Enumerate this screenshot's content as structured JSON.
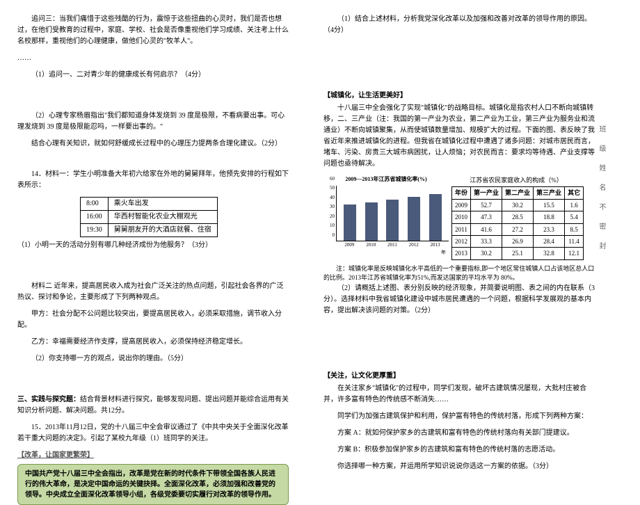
{
  "left": {
    "zw3_label": "追问三：",
    "zw3_text": "当我们痛惜于这些残酷的行为，震惊于这些扭曲的心灵时，我们是否也想过，在他们受教育的过程中，家庭、学校、社会是否像重视他们学习成绩、关注考上什么名校那样，重视他们的心理健康，做他们心灵的\"牧羊人\"。",
    "ellipsis": "……",
    "q1": "（1）追问一、二对青少年的健康成长有何启示？（4分）",
    "q2a": "（2）心理专家杨眉指出\"我们都知道身体发烧到 39 度是极限，不看病要出事。可心理发烧到 39 度是极限能忍吗，一样要出事的。\"",
    "q2b": "结合心理有关知识，就如何舒缓成长过程中的心理压力提两条合理化建议。（2分）",
    "item14": "14．材料一：学生小明准备大年初六给家在外地的舅舅拜年，他预先安排的行程如下表所示：",
    "schedule": [
      [
        "8:00",
        "乘火车出发"
      ],
      [
        "16:00",
        "华西村智能化农业大棚观光"
      ],
      [
        "19:30",
        "舅舅朋友开的大酒店就餐、住宿"
      ]
    ],
    "q14_1": "（1）小明一天的活动分别有哪几种经济成份为他服务？（3分）",
    "mat2": "材料二 近年来，提高居民收入成为社会广泛关注的热点问题，引起社会各界的广泛热议、探讨和争论，主要形成了下列两种观点。",
    "jia": "甲方：社会分配不公问题比较突出，要提高居民收入，必须采取措施，调节收入分配。",
    "yi": "乙方：幸福需要经济作支撑，提高居民收入，必须保持经济稳定增长。",
    "q14_2": "（2）你支持哪一方的观点，说出你的理由。（5分）",
    "section3": "三、实践与探究题：",
    "section3_desc": "结合背景材料进行探究，能够发现问题、提出问题并能综合运用有关知识分析问题、解决问题。共12分。",
    "item15": "15．2013年11月12日，党的十八届三中全会审议通过了《中共中央关于全面深化改革若干重大问题的决定》。引起了某校九年级（1）班同学的关注。",
    "reform_head": "【改革，让国家更繁荣】",
    "reform_box": "中国共产党十八届三中全会指出，改革是党在新的时代条件下带领全国各族人民进行的伟大革命，是决定中国命运的关键抉择。全面深化改革，必须加强和改善党的领导。中央成立全面深化改革领导小组，各级党委要切实履行对改革的领导作用。"
  },
  "right": {
    "q15_1": "（1）结合上述材料，分析我党深化改革以及加强和改善对改革的领导作用的原因。（4分）",
    "urban_head": "【城镇化，让生活更美好】",
    "urban_p1": "十八届三中全会强化了实现\"城镇化\"的战略目标。城镇化是指农村人口不断向城镇转移，二、三产业（注：我国的第一产业为农业，第二产业为工业，第三产业为服务业和流通业）不断向城镇聚集，从而使城镇数量增加、规模扩大的过程。下面的图、表反映了我省近年来推进城镇化的进程。但我省在城镇化过程中遭遇了诸多问题：对城市居民而言，堵车、污染、房贵三大城市病困扰，让人烦恼；对农民而言：要求均等待遇、产业支撑等问题也亟待解决。",
    "chart_title": "2009—2013年江苏省城镇化率(%)",
    "table_title": "江苏省农民家庭收入的构成（%）",
    "table_head": [
      "年份",
      "第一产业",
      "第二产业",
      "第三产业",
      "其它"
    ],
    "table_rows": [
      [
        "2009",
        "52.7",
        "30.2",
        "15.5",
        "1.6"
      ],
      [
        "2010",
        "47.3",
        "28.5",
        "18.8",
        "5.4"
      ],
      [
        "2011",
        "41.6",
        "27.2",
        "23.3",
        "8.5"
      ],
      [
        "2012",
        "33.3",
        "26.9",
        "28.4",
        "11.4"
      ],
      [
        "2013",
        "30.2",
        "25.1",
        "32.8",
        "12.1"
      ]
    ],
    "chart_note1": "注：城镇化率是反映城镇化水平高低的一个重要指标,即一个地区常住城镇人口占该地区总人口的比例。2013年江苏省城镇化率为51%,而发达国家的平均水平为 80%。",
    "q15_2": "（2）请概括上述图、表分别反映的经济现象，并简要说明图、表之间的内在联系（3分）。选择材料中我省城镇化建设中城市居民遭遇的一个问题，根据科学发展观的基本内容，提出解决该问题的对策。（2分）",
    "culture_head": "【关注，让文化更厚重】",
    "culture_p1": "在关注家乡\"城镇化\"的过程中，同学们发现，破坏古建筑情况屡现，大批村庄被合并，许多富有特色的传统感不断消失……",
    "culture_p2": "同学们为加强古建筑保护和利用，保护富有特色的传统村落，形成下列两种方案：",
    "planA": "方案 A：就如何保护家乡的古建筑和富有特色的传统村落向有关部门提建议。",
    "planB": "方案 B：积极参加保护家乡的古建筑和富有特色的传统村落的志愿活动。",
    "culture_q": "你选择哪一种方案，并运用所学知识说说你选这一方案的依据。（3分）",
    "side": "班级姓名不密封"
  },
  "chart_data": {
    "type": "bar",
    "title": "2009—2013年江苏省城镇化率(%)",
    "categories": [
      "2009",
      "2010",
      "2011",
      "2012",
      "2013"
    ],
    "values": [
      40,
      42,
      45,
      48,
      51
    ],
    "xlabel": "年",
    "ylabel": "",
    "ylim": [
      0,
      60
    ],
    "yticks": [
      0,
      10,
      20,
      30,
      40,
      50,
      60
    ]
  }
}
